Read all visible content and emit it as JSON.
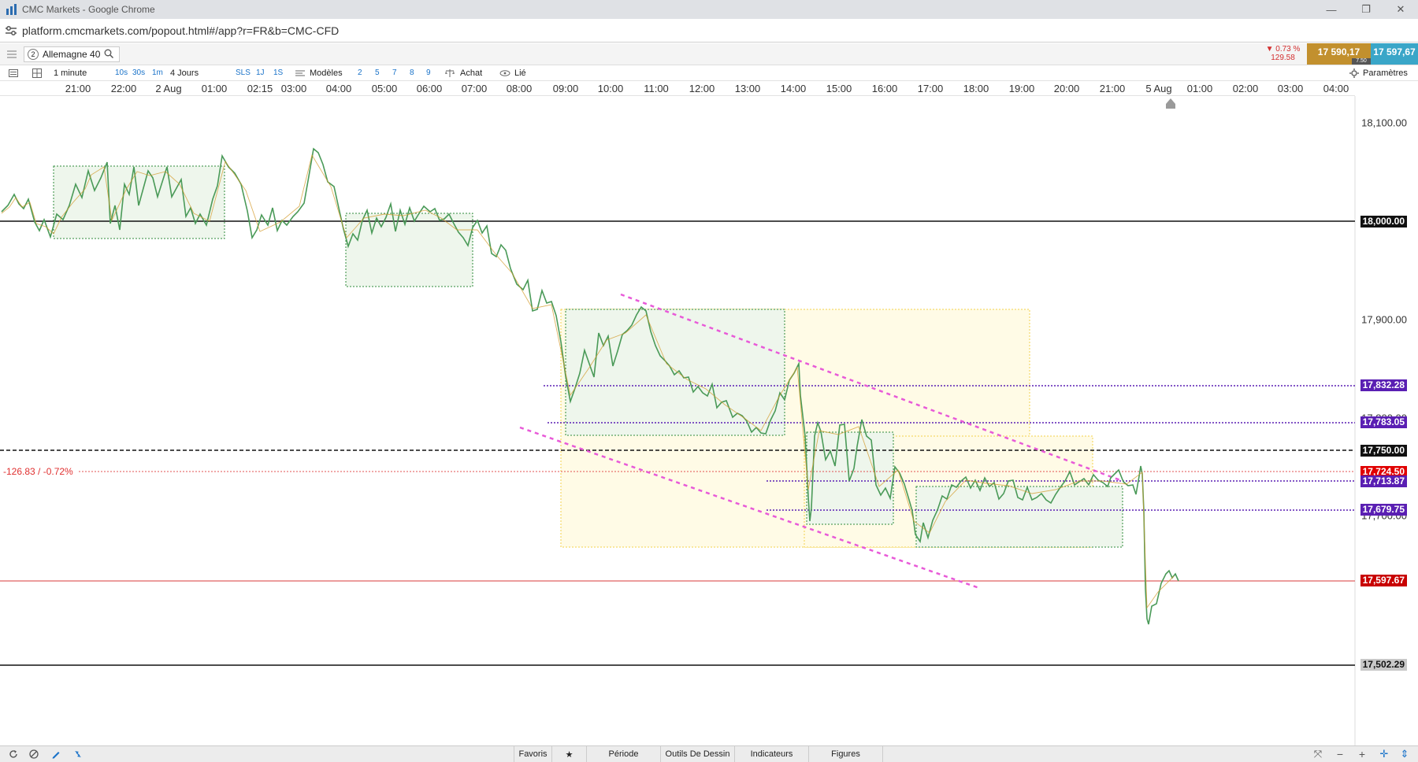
{
  "window": {
    "title": "CMC Markets - Google Chrome",
    "url": "platform.cmcmarkets.com/popout.html#/app?r=FR&b=CMC-CFD"
  },
  "toolbar": {
    "badge": "2",
    "instrument": "Allemagne 40",
    "change_pct": "▼ 0.73 %",
    "change_pts": "129.58",
    "sell_price": "17 590,17",
    "buy_price": "17 597,67",
    "spread": "7.50"
  },
  "toolbar2": {
    "interval": "1 minute",
    "quick_intervals": [
      "10s",
      "30s",
      "1m"
    ],
    "period": "4 Jours",
    "quick_periods": [
      "SLS",
      "1J",
      "1S"
    ],
    "templates": "Modèles",
    "template_slots": [
      "2",
      "5",
      "7",
      "8",
      "9"
    ],
    "buy_label": "Achat",
    "linked_label": "Lié",
    "settings_label": "Paramètres"
  },
  "time_axis": [
    "21:00",
    "22:00",
    "2 Aug",
    "01:00",
    "02:15",
    "03:00",
    "04:00",
    "05:00",
    "06:00",
    "07:00",
    "08:00",
    "09:00",
    "10:00",
    "11:00",
    "12:00",
    "13:00",
    "14:00",
    "15:00",
    "16:00",
    "17:00",
    "18:00",
    "19:00",
    "20:00",
    "21:00",
    "5 Aug",
    "01:00",
    "02:00",
    "03:00",
    "04:00"
  ],
  "price_axis": [
    "18,100.00",
    "17,900.00",
    "17,800.00",
    "17,700.00"
  ],
  "level_tags": [
    {
      "label": "18,000.00",
      "kind": "black"
    },
    {
      "label": "17,832.28",
      "kind": "purple"
    },
    {
      "label": "17,783.05",
      "kind": "purple"
    },
    {
      "label": "17,750.00",
      "kind": "black"
    },
    {
      "label": "17,724.50",
      "kind": "red"
    },
    {
      "label": "17,713.87",
      "kind": "purple"
    },
    {
      "label": "17,679.75",
      "kind": "purple"
    },
    {
      "label": "17,597.67",
      "kind": "darkred"
    },
    {
      "label": "17,502.29",
      "kind": "grey"
    }
  ],
  "change_annotation": "-126.83 / -0.72%",
  "bottom": {
    "tabs": [
      "Favoris",
      "Période",
      "Outils De Dessin",
      "Indicateurs",
      "Figures"
    ]
  },
  "colors": {
    "candle_up": "#3f9a52",
    "candle_down": "#d39a2a",
    "purple_line": "#5a1fb3",
    "magenta_trend": "#e85ad8",
    "red_line": "#d93a3a"
  }
}
